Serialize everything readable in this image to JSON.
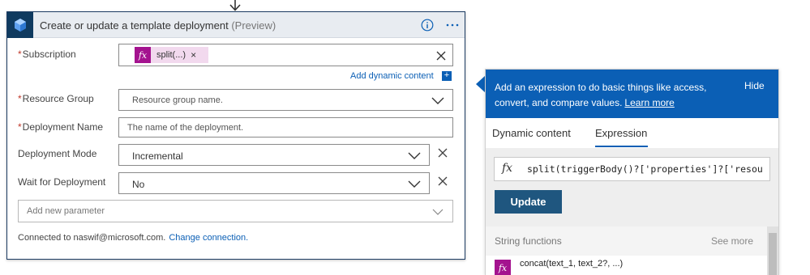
{
  "card": {
    "title": "Create or update a template deployment",
    "title_suffix": "(Preview)",
    "icons": {
      "logo": "azure-resource-manager-icon",
      "info": "info-icon",
      "more": "more-options-icon"
    }
  },
  "fields": {
    "subscription": {
      "label": "Subscription",
      "required": "*",
      "token_label": "split(...)",
      "token_remove": "×"
    },
    "dynamic_content_link": "Add dynamic content",
    "dynamic_content_plus": "+",
    "resource_group": {
      "label": "Resource Group",
      "required": "*",
      "placeholder": "Resource group name."
    },
    "deployment_name": {
      "label": "Deployment Name",
      "required": "*",
      "placeholder": "The name of the deployment."
    },
    "deployment_mode": {
      "label": "Deployment Mode",
      "value": "Incremental"
    },
    "wait_for_deployment": {
      "label": "Wait for Deployment",
      "value": "No"
    },
    "add_new_parameter": {
      "placeholder": "Add new parameter"
    }
  },
  "footer": {
    "connected_text": "Connected to naswif@microsoft.com.",
    "change_link": "Change connection."
  },
  "expression_panel": {
    "banner_text": "Add an expression to do basic things like access, convert, and compare values.",
    "learn_more": "Learn more",
    "hide": "Hide",
    "tabs": [
      {
        "label": "Dynamic content",
        "active": false
      },
      {
        "label": "Expression",
        "active": true
      }
    ],
    "fx_symbol": "fx",
    "expression": "split(triggerBody()?['properties']?['resou",
    "update_button": "Update",
    "string_functions_title": "String functions",
    "see_more": "See more",
    "functions": [
      {
        "name": "concat(text_1, text_2?, ...)"
      }
    ]
  },
  "colors": {
    "accent": "#0b5fb5",
    "token": "#a4138f",
    "token_bg": "#f2d9ee",
    "header_bg": "#e8ecf1",
    "update_button": "#1f567f",
    "card_border": "#1d3c63"
  }
}
